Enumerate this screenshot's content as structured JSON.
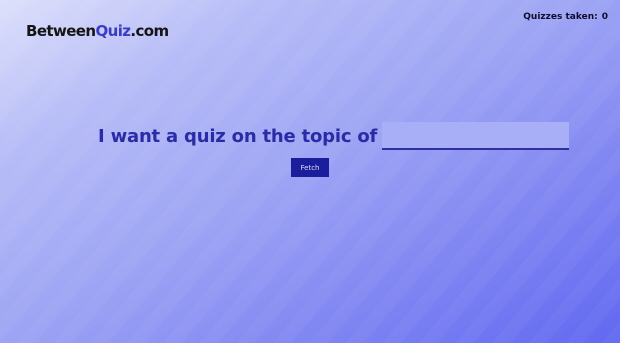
{
  "logo": {
    "prefix": "Between",
    "accent": "Quiz",
    "suffix": ".com"
  },
  "header": {
    "quizzes_taken_label": "Quizzes taken:",
    "quizzes_taken_count": "0"
  },
  "main": {
    "prompt": "I want a quiz on the topic of",
    "topic_input_value": "",
    "fetch_label": "Fetch"
  },
  "colors": {
    "accent": "#3a3cc4",
    "prompt_text": "#2a2ba6",
    "button": "#1b1e9c"
  }
}
